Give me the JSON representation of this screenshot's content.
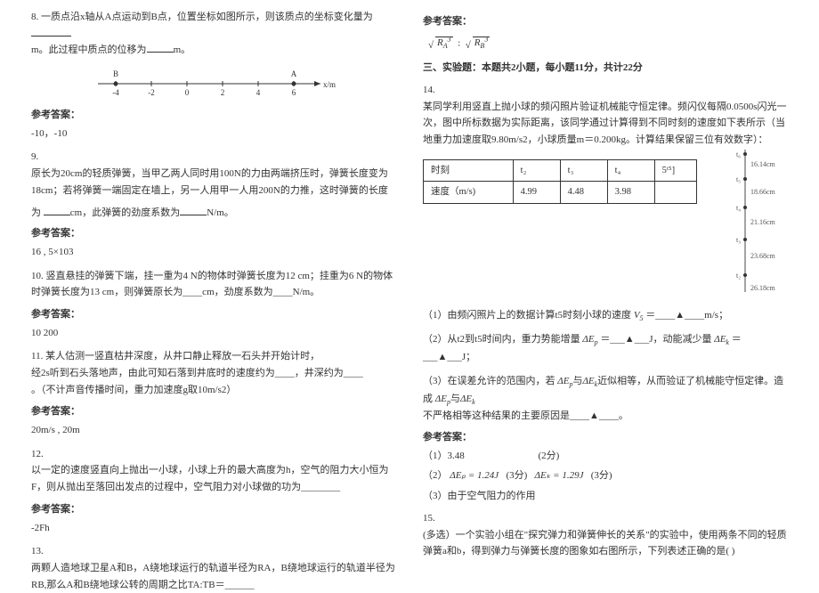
{
  "left": {
    "q8": {
      "text_a": "8. 一质点沿x轴从A点运动到B点，位置坐标如图所示，则该质点的坐标变化量为",
      "text_b": "m。此过程中质点的位移为",
      "text_c": "m。",
      "axis_label": "x/m",
      "ticks": [
        "-4",
        "-2",
        "0",
        "2",
        "4",
        "6"
      ],
      "points": {
        "B": "B",
        "A": "A"
      },
      "ans_label": "参考答案：",
      "ans": "-10，-10"
    },
    "q9": {
      "text_a": "9.",
      "text_b": "原长为20cm的轻质弹簧，当甲乙两人同时用100N的力由两端挤压时，弹簧长度变为18cm；若将弹簧一端固定在墙上，另一人用甲一人用200N的力推，这时弹簧的长度",
      "text_c": "为",
      "text_d": "cm，此弹簧的劲度系数为",
      "text_e": "N/m。",
      "ans_label": "参考答案：",
      "ans": "16 , 5×103"
    },
    "q10": {
      "text": "10. 竖直悬挂的弹簧下端，挂一重为4 N的物体时弹簧长度为12 cm；挂重为6 N的物体时弹簧长度为13 cm，则弹簧原长为____cm，劲度系数为____N/m。",
      "ans_label": "参考答案：",
      "ans": "10    200"
    },
    "q11": {
      "text_a": "11. 某人估测一竖直枯井深度，从井口静止释放一石头并开始计时，",
      "text_b": "经2s听到石头落地声，由此可知石落到井底时的速度约为____，井深约为____",
      "text_c": "。（不计声音传播时间，重力加速度g取10m/s2）",
      "ans_label": "参考答案：",
      "ans": "20m/s , 20m"
    },
    "q12": {
      "num": "12.",
      "text_a": "以一定的速度竖直向上抛出一小球，小球上升的最大高度为h，空气的阻力大小恒为F，则从抛出至落回出发点的过程中，空气阻力对小球做的功为________",
      "ans_label": "参考答案：",
      "ans": "-2Fh"
    },
    "q13": {
      "num": "13.",
      "text": "两颗人造地球卫星A和B，A绕地球运行的轨道半径为RA，B绕地球运行的轨道半径为RB,那么A和B绕地球公转的周期之比TA:TB＝______"
    }
  },
  "right": {
    "ans_label_top": "参考答案：",
    "formula_ra": "R",
    "formula_rb": "R",
    "section3": "三、实验题：本题共2小题，每小题11分，共计22分",
    "q14": {
      "num": "14.",
      "intro": "某同学利用竖直上抛小球的频闪照片验证机械能守恒定律。频闪仪每隔0.0500s闪光一次，图中所标数据为实际距离，该同学通过计算得到不同时刻的速度如下表所示（当地重力加速度取9.80m/s2，小球质量m＝0.200kg。计算结果保留三位有效数字）：",
      "table": {
        "h1": "时刻",
        "h2": "t₂",
        "h3": "t₃",
        "h4": "t₄",
        "h5": "5ᵗ⁵]",
        "r1": "速度（m/s)",
        "v2": "4.99",
        "v3": "4.48",
        "v4": "3.98",
        "v5": ""
      },
      "ruler_vals": [
        "16.14cm",
        "18.66cm",
        "21.16cm",
        "23.68cm",
        "26.18cm"
      ],
      "ruler_ticks": [
        "t₆",
        "t₅",
        "t₄",
        "t₃",
        "t₂"
      ],
      "p1_a": "（1）由频闪照片上的数据计算t5时刻小球的速度",
      "p1_b": "＝____▲____m/s；",
      "p2_a": "（2）从t2到t5时间内，重力势能增量",
      "p2_b": "＝___▲___J，动能减少量",
      "p2_c": "＝___▲___J；",
      "p3_a": "（3）在误差允许的范围内，若",
      "p3_b": "与",
      "p3_c": "近似相等，从而验证了机械能守恒定律。造成",
      "p3_d": "与",
      "p3_e": "不严格相等这种结果的主要原因是____▲____。",
      "ans_label": "参考答案：",
      "a1": "（1）3.48",
      "a1_score": "(2分)",
      "a2_a": "（2）",
      "a2_ep": "ΔEₚ = 1.24J",
      "a2_score1": "(3分)",
      "a2_ek": "ΔEₖ = 1.29J",
      "a2_score2": "(3分)",
      "a3": "（3）由于空气阻力的作用"
    },
    "q15": {
      "num": "15.",
      "text": "(多选）一个实验小组在\"探究弹力和弹簧伸长的关系\"的实验中，使用两条不同的轻质弹簧a和b，得到弹力与弹簧长度的图象如右图所示，下列表述正确的是(    )"
    }
  }
}
